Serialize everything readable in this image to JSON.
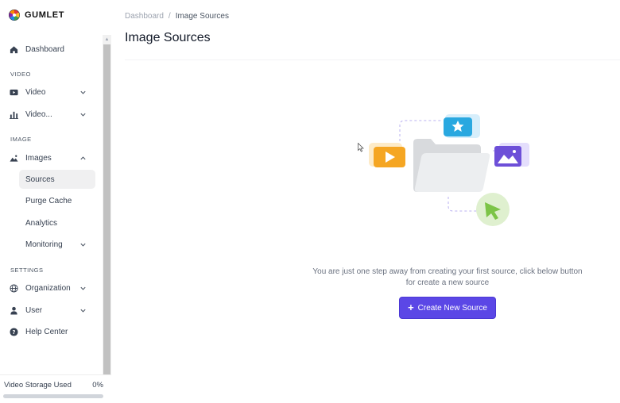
{
  "brand": {
    "name": "GUMLET"
  },
  "sidebar": {
    "items": [
      {
        "label": "Dashboard",
        "icon": "home-icon"
      },
      {
        "section": "VIDEO"
      },
      {
        "label": "Video",
        "icon": "video-icon",
        "expandable": true
      },
      {
        "label": "Video...",
        "icon": "bar-chart-icon",
        "expandable": true
      },
      {
        "section": "IMAGE"
      },
      {
        "label": "Images",
        "icon": "image-icon",
        "expanded": true
      },
      {
        "label": "Sources",
        "active": true
      },
      {
        "label": "Purge Cache"
      },
      {
        "label": "Analytics"
      },
      {
        "label": "Monitoring",
        "expandable": true
      },
      {
        "section": "SETTINGS"
      },
      {
        "label": "Organization",
        "icon": "globe-icon",
        "expandable": true
      },
      {
        "label": "User",
        "icon": "user-icon",
        "expandable": true
      },
      {
        "label": "Help Center",
        "icon": "help-icon"
      }
    ],
    "storage": {
      "label": "Video Storage Used",
      "percent_text": "0%",
      "fraction": 0
    }
  },
  "breadcrumb": {
    "root": "Dashboard",
    "separator": "/",
    "current": "Image Sources"
  },
  "page": {
    "title": "Image Sources",
    "empty_message": "You are just one step away from creating your first source, click below button for create a new source",
    "create_button": "Create New Source"
  },
  "colors": {
    "accent": "#5b47e6",
    "play": "#f5a623",
    "star_card": "#29a8e0",
    "image_card": "#6d4fd8",
    "cursor_green": "#7cc447"
  }
}
